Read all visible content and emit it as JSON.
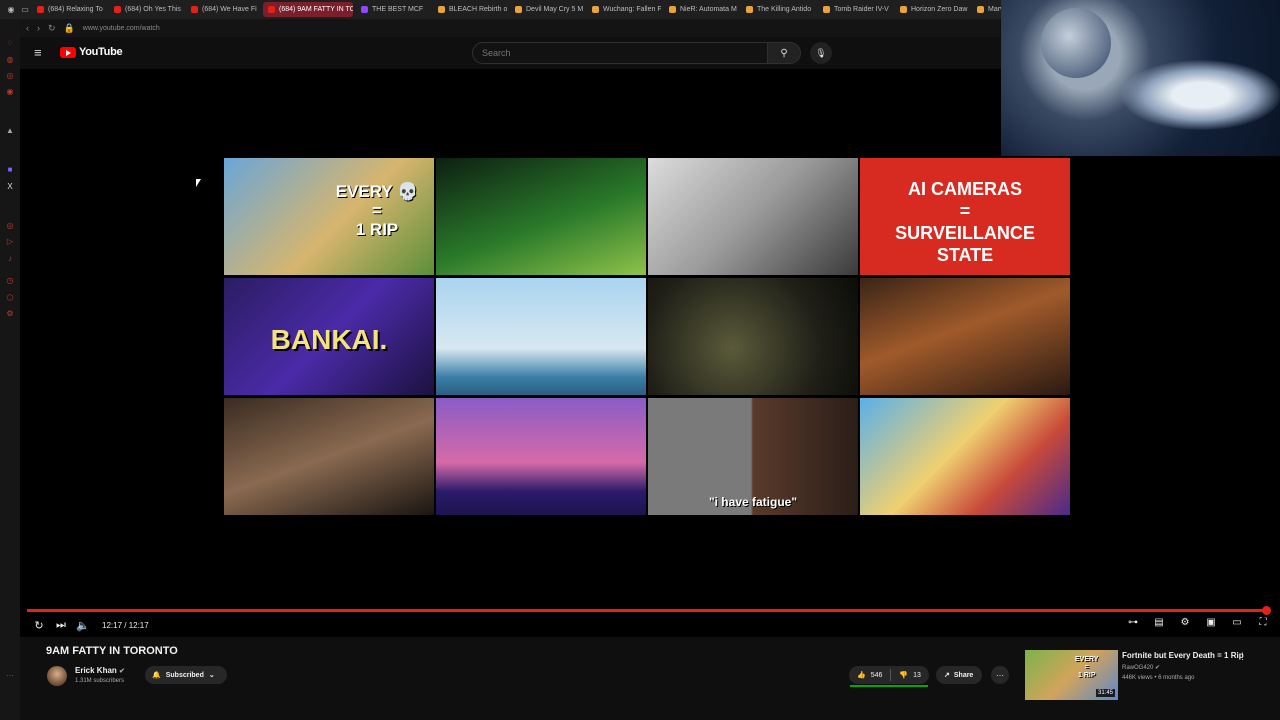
{
  "browser": {
    "tabs": [
      {
        "title": "(684) Relaxing To",
        "color": "#e62117"
      },
      {
        "title": "(684) Oh Yes This",
        "color": "#e62117"
      },
      {
        "title": "(684) We Have Fi",
        "color": "#e62117"
      },
      {
        "title": "(684) 9AM FATTY IN TO",
        "color": "#e62117",
        "active": true
      },
      {
        "title": "THE BEST MCF",
        "color": "#9146ff"
      },
      {
        "title": "BLEACH Rebirth o",
        "color": "#e8a33d"
      },
      {
        "title": "Devil May Cry 5 M",
        "color": "#e8a33d"
      },
      {
        "title": "Wuchang: Fallen F",
        "color": "#e8a33d"
      },
      {
        "title": "NieR: Automata M",
        "color": "#e8a33d"
      },
      {
        "title": "The Killing Antido",
        "color": "#e8a33d"
      },
      {
        "title": "Tomb Raider IV-V",
        "color": "#e8a33d"
      },
      {
        "title": "Horizon Zero Daw",
        "color": "#e8a33d"
      },
      {
        "title": "Marve",
        "color": "#e8a33d"
      }
    ],
    "url": "www.youtube.com/watch"
  },
  "masthead": {
    "logo_text": "YouTube",
    "search_placeholder": "Search"
  },
  "player": {
    "time": "12:17 / 12:17",
    "progress": 1.0,
    "thumb_captions": {
      "t1": "EVERY 💀\n=\n1 RIP",
      "t4": "AI CAMERAS\n=\nSURVEILLANCE\nSTATE",
      "t5": "BANKAI.",
      "t11": "\"i have fatigue\""
    }
  },
  "video": {
    "title": "9AM FATTY IN TORONTO",
    "channel": "Erick Khan",
    "subscribers": "1.31M subscribers",
    "subscribe_label": "Subscribed",
    "likes": "546",
    "dislikes": "13",
    "share_label": "Share"
  },
  "recommended": {
    "title": "Fortnite but Every Death = 1 Rip",
    "channel": "RawOG420",
    "meta": "446K views • 6 months ago",
    "duration": "31:45",
    "thumb_caption": "EVERY\n=\n1 RIP"
  },
  "colors": {
    "accent": "#e62117",
    "background": "#0f0f0f"
  }
}
